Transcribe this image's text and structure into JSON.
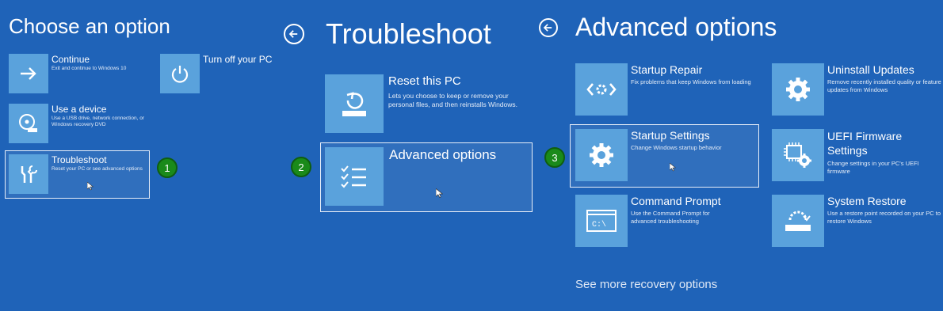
{
  "colors": {
    "background": "#1f63b8",
    "tile": "#5aa2dc",
    "badge": "#1a8a1a"
  },
  "choose": {
    "title": "Choose an option",
    "tiles": [
      {
        "icon": "arrow-right-icon",
        "label": "Continue",
        "desc": "Exit and continue to Windows 10"
      },
      {
        "icon": "power-icon",
        "label": "Turn off your PC",
        "desc": ""
      },
      {
        "icon": "disc-icon",
        "label": "Use a device",
        "desc": "Use a USB drive, network connection, or Windows recovery DVD"
      },
      {
        "icon": "tools-icon",
        "label": "Troubleshoot",
        "desc": "Reset your PC or see advanced options"
      }
    ],
    "step": "1"
  },
  "troubleshoot": {
    "title": "Troubleshoot",
    "tiles": [
      {
        "icon": "reset-icon",
        "label": "Reset this PC",
        "desc": "Lets you choose to keep or remove your personal files, and then reinstalls Windows."
      },
      {
        "icon": "checklist-icon",
        "label": "Advanced options",
        "desc": ""
      }
    ],
    "step": "2"
  },
  "advanced": {
    "title": "Advanced options",
    "tiles": [
      {
        "icon": "startup-repair-icon",
        "label": "Startup Repair",
        "desc": "Fix problems that keep Windows from loading"
      },
      {
        "icon": "gear-icon",
        "label": "Uninstall Updates",
        "desc": "Remove recently installed quality or feature updates from Windows"
      },
      {
        "icon": "gear-icon",
        "label": "Startup Settings",
        "desc": "Change Windows startup behavior"
      },
      {
        "icon": "firmware-icon",
        "label": "UEFI Firmware Settings",
        "desc": "Change settings in your PC's UEFI firmware"
      },
      {
        "icon": "command-prompt-icon",
        "label": "Command Prompt",
        "desc": "Use the Command Prompt for advanced troubleshooting"
      },
      {
        "icon": "restore-icon",
        "label": "System Restore",
        "desc": "Use a restore point recorded on your PC to restore Windows"
      }
    ],
    "cmd_glyph": "C:\\",
    "more": "See more recovery options",
    "step": "3"
  }
}
